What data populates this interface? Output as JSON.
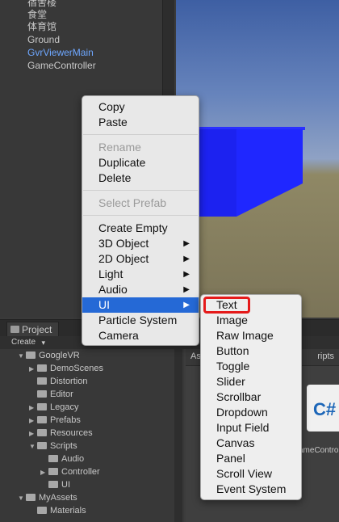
{
  "hierarchy": {
    "items": [
      "宿舍楼",
      "食堂",
      "体育馆",
      "Ground",
      "GvrViewerMain",
      "GameController"
    ],
    "active_item": "GvrViewerMain"
  },
  "project": {
    "tab_label": "Project",
    "create_label": "Create",
    "tree": [
      {
        "label": "GoogleVR",
        "expanded": true
      },
      {
        "label": "DemoScenes",
        "expanded": false
      },
      {
        "label": "Distortion",
        "expanded": null
      },
      {
        "label": "Editor",
        "expanded": null
      },
      {
        "label": "Legacy",
        "expanded": false
      },
      {
        "label": "Prefabs",
        "expanded": false
      },
      {
        "label": "Resources",
        "expanded": false
      },
      {
        "label": "Scripts",
        "expanded": true
      },
      {
        "label": "Audio",
        "expanded": null
      },
      {
        "label": "Controller",
        "expanded": false
      },
      {
        "label": "UI",
        "expanded": null
      },
      {
        "label": "MyAssets",
        "expanded": true
      },
      {
        "label": "Materials",
        "expanded": null
      }
    ],
    "assets_breadcrumb_left": "As",
    "assets_breadcrumb_right": "ripts",
    "asset_icon_text": "C#",
    "asset_label": "ameContro"
  },
  "context_menu": {
    "items": [
      {
        "label": "Copy",
        "enabled": true
      },
      {
        "label": "Paste",
        "enabled": true
      },
      {
        "label": "Rename",
        "enabled": false
      },
      {
        "label": "Duplicate",
        "enabled": true
      },
      {
        "label": "Delete",
        "enabled": true
      },
      {
        "label": "Select Prefab",
        "enabled": false
      },
      {
        "label": "Create Empty",
        "enabled": true
      },
      {
        "label": "3D Object",
        "enabled": true,
        "submenu": true
      },
      {
        "label": "2D Object",
        "enabled": true,
        "submenu": true
      },
      {
        "label": "Light",
        "enabled": true,
        "submenu": true
      },
      {
        "label": "Audio",
        "enabled": true,
        "submenu": true
      },
      {
        "label": "UI",
        "enabled": true,
        "submenu": true,
        "selected": true
      },
      {
        "label": "Particle System",
        "enabled": true
      },
      {
        "label": "Camera",
        "enabled": true
      }
    ]
  },
  "ui_submenu": {
    "items": [
      "Text",
      "Image",
      "Raw Image",
      "Button",
      "Toggle",
      "Slider",
      "Scrollbar",
      "Dropdown",
      "Input Field",
      "Canvas",
      "Panel",
      "Scroll View",
      "Event System"
    ],
    "highlighted": "Text"
  },
  "colors": {
    "selection": "#2569d6",
    "highlight_box": "#e51a1a",
    "cube": "#1f27ff",
    "active_hierarchy_text": "#6ea7ff"
  }
}
